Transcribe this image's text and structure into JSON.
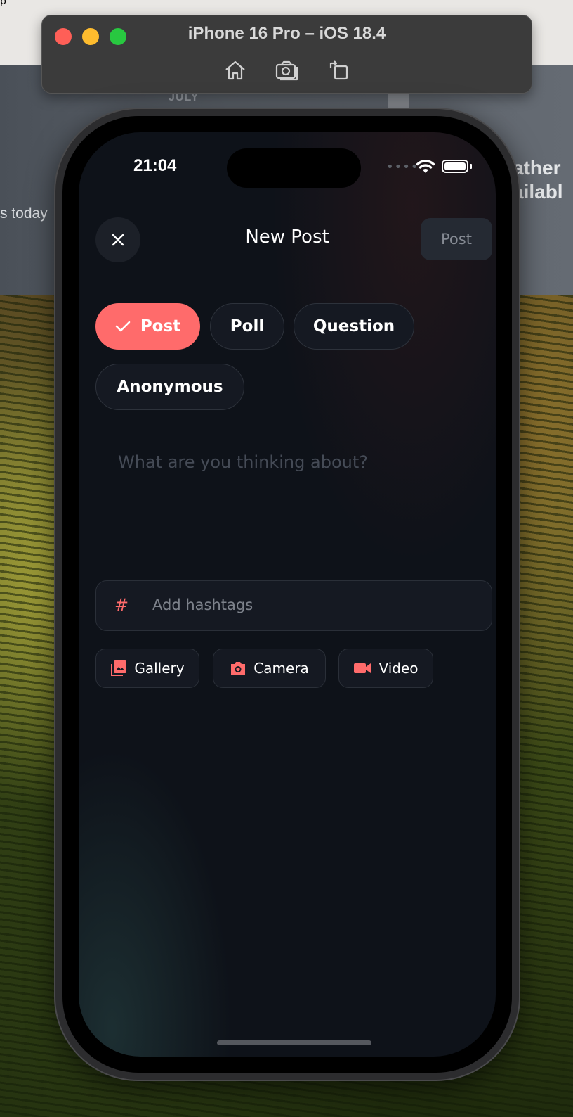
{
  "desktop": {
    "corner_text": "p",
    "bg_month": "JULY",
    "bg_left_text": "s today",
    "bg_right_text_1": "ather",
    "bg_right_text_2": "ailabl"
  },
  "simulator": {
    "title": "iPhone 16 Pro – iOS 18.4",
    "controls": [
      {
        "name": "home",
        "icon": "home-icon"
      },
      {
        "name": "screenshot",
        "icon": "camera-icon"
      },
      {
        "name": "rotate",
        "icon": "rotate-icon"
      }
    ]
  },
  "status_bar": {
    "time": "21:04",
    "signal": "••••"
  },
  "header": {
    "title": "New Post",
    "post_label": "Post"
  },
  "post_types": [
    {
      "label": "Post",
      "selected": true
    },
    {
      "label": "Poll",
      "selected": false
    },
    {
      "label": "Question",
      "selected": false
    },
    {
      "label": "Anonymous",
      "selected": false
    }
  ],
  "compose": {
    "placeholder": "What are you thinking about?"
  },
  "hashtags": {
    "icon": "#",
    "placeholder": "Add hashtags"
  },
  "media": [
    {
      "label": "Gallery",
      "icon": "gallery-icon"
    },
    {
      "label": "Camera",
      "icon": "camera-icon"
    },
    {
      "label": "Video",
      "icon": "video-icon"
    }
  ],
  "colors": {
    "accent": "#ff6b6b",
    "screen_bg": "#0e1219",
    "surface": "#151922",
    "border": "#2a2f38"
  }
}
